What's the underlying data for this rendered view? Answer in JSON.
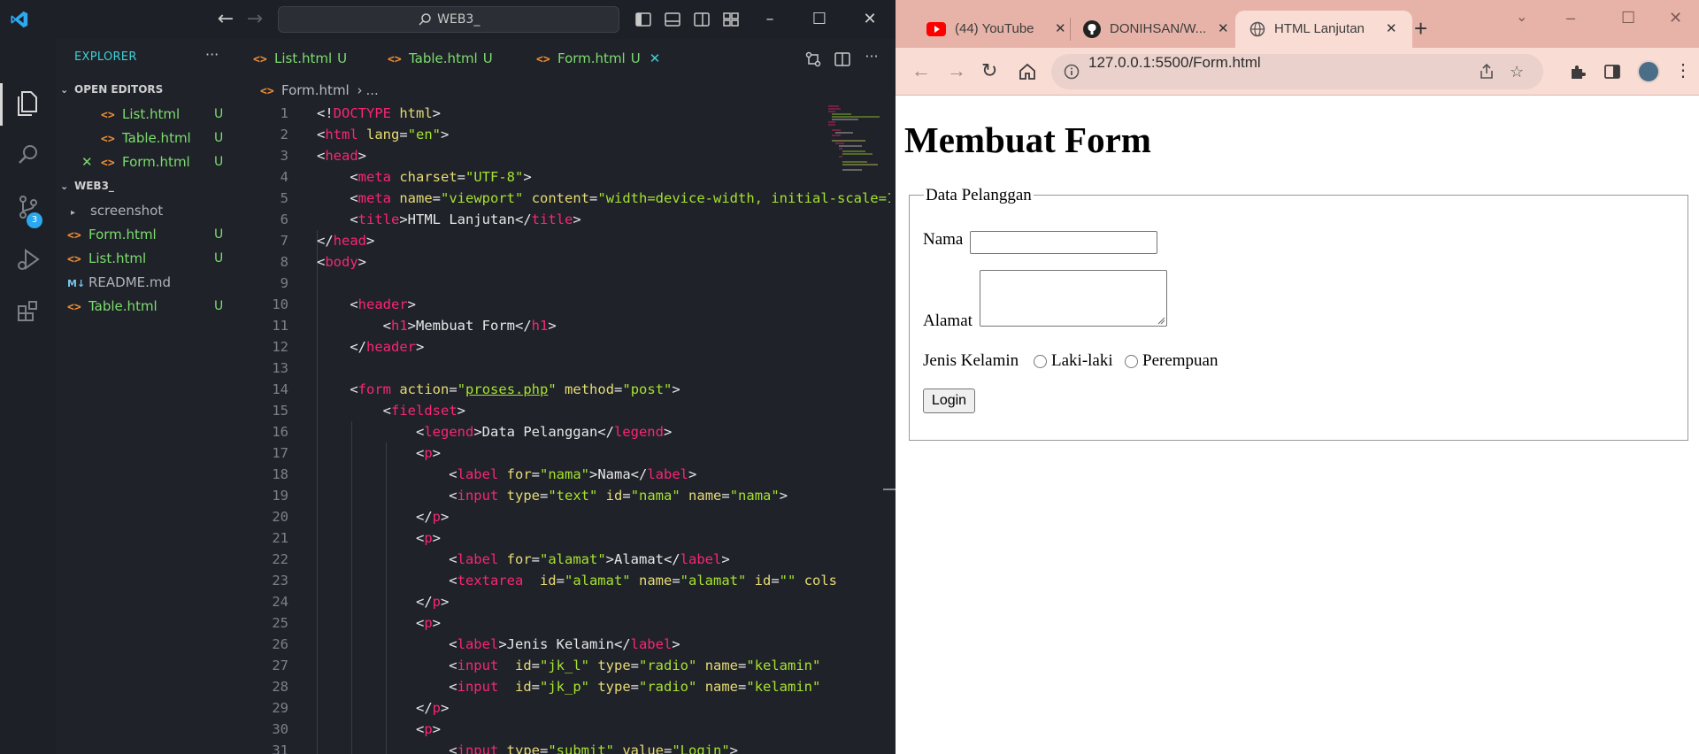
{
  "vscode": {
    "search_title": "WEB3_",
    "explorer_title": "EXPLORER",
    "more": "···",
    "open_editors_label": "OPEN EDITORS",
    "workspace_label": "WEB3_",
    "scm_badge": "3",
    "open_editors": [
      {
        "name": "List.html",
        "status": "U"
      },
      {
        "name": "Table.html",
        "status": "U"
      },
      {
        "name": "Form.html",
        "status": "U"
      }
    ],
    "files": [
      {
        "name": "screenshot",
        "status": ""
      },
      {
        "name": "Form.html",
        "status": "U"
      },
      {
        "name": "List.html",
        "status": "U"
      },
      {
        "name": "README.md",
        "status": ""
      },
      {
        "name": "Table.html",
        "status": "U"
      }
    ],
    "tabs": [
      {
        "name": "List.html",
        "status": "U"
      },
      {
        "name": "Table.html",
        "status": "U"
      },
      {
        "name": "Form.html",
        "status": "U"
      }
    ],
    "breadcrumb": {
      "file": "Form.html",
      "rest": "..."
    },
    "code_lines": [
      {
        "n": "1"
      },
      {
        "n": "2"
      },
      {
        "n": "3"
      },
      {
        "n": "4"
      },
      {
        "n": "5"
      },
      {
        "n": "6"
      },
      {
        "n": "7"
      },
      {
        "n": "8"
      },
      {
        "n": "9"
      },
      {
        "n": "10"
      },
      {
        "n": "11"
      },
      {
        "n": "12"
      },
      {
        "n": "13"
      },
      {
        "n": "14"
      },
      {
        "n": "15"
      },
      {
        "n": "16"
      },
      {
        "n": "17"
      },
      {
        "n": "18"
      },
      {
        "n": "19"
      },
      {
        "n": "20"
      },
      {
        "n": "21"
      },
      {
        "n": "22"
      },
      {
        "n": "23"
      },
      {
        "n": "24"
      },
      {
        "n": "25"
      },
      {
        "n": "26"
      },
      {
        "n": "27"
      },
      {
        "n": "28"
      },
      {
        "n": "29"
      },
      {
        "n": "30"
      },
      {
        "n": "31"
      }
    ]
  },
  "chrome": {
    "tabs": [
      {
        "title": "(44) YouTube"
      },
      {
        "title": "DONIHSAN/W..."
      },
      {
        "title": "HTML Lanjutan"
      }
    ],
    "url": "127.0.0.1:5500/Form.html",
    "page": {
      "heading": "Membuat Form",
      "legend": "Data Pelanggan",
      "nama_label": "Nama",
      "alamat_label": "Alamat",
      "jk_label": "Jenis Kelamin",
      "radio_1": "Laki-laki",
      "radio_2": "Perempuan",
      "submit": "Login"
    }
  },
  "colors": {
    "vscode_bg": "#1f2229",
    "accent_cyan": "#3ed0d4",
    "git_untracked": "#7ddc6e",
    "chrome_frame": "#e7b3a8"
  }
}
